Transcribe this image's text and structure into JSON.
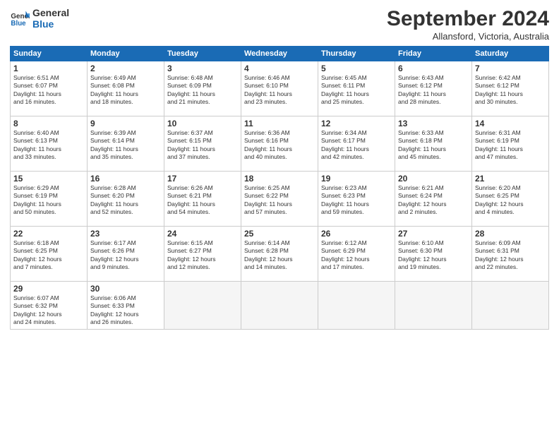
{
  "logo": {
    "line1": "General",
    "line2": "Blue"
  },
  "title": "September 2024",
  "location": "Allansford, Victoria, Australia",
  "days_header": [
    "Sunday",
    "Monday",
    "Tuesday",
    "Wednesday",
    "Thursday",
    "Friday",
    "Saturday"
  ],
  "weeks": [
    [
      {
        "day": "1",
        "text": "Sunrise: 6:51 AM\nSunset: 6:07 PM\nDaylight: 11 hours\nand 16 minutes."
      },
      {
        "day": "2",
        "text": "Sunrise: 6:49 AM\nSunset: 6:08 PM\nDaylight: 11 hours\nand 18 minutes."
      },
      {
        "day": "3",
        "text": "Sunrise: 6:48 AM\nSunset: 6:09 PM\nDaylight: 11 hours\nand 21 minutes."
      },
      {
        "day": "4",
        "text": "Sunrise: 6:46 AM\nSunset: 6:10 PM\nDaylight: 11 hours\nand 23 minutes."
      },
      {
        "day": "5",
        "text": "Sunrise: 6:45 AM\nSunset: 6:11 PM\nDaylight: 11 hours\nand 25 minutes."
      },
      {
        "day": "6",
        "text": "Sunrise: 6:43 AM\nSunset: 6:12 PM\nDaylight: 11 hours\nand 28 minutes."
      },
      {
        "day": "7",
        "text": "Sunrise: 6:42 AM\nSunset: 6:12 PM\nDaylight: 11 hours\nand 30 minutes."
      }
    ],
    [
      {
        "day": "8",
        "text": "Sunrise: 6:40 AM\nSunset: 6:13 PM\nDaylight: 11 hours\nand 33 minutes."
      },
      {
        "day": "9",
        "text": "Sunrise: 6:39 AM\nSunset: 6:14 PM\nDaylight: 11 hours\nand 35 minutes."
      },
      {
        "day": "10",
        "text": "Sunrise: 6:37 AM\nSunset: 6:15 PM\nDaylight: 11 hours\nand 37 minutes."
      },
      {
        "day": "11",
        "text": "Sunrise: 6:36 AM\nSunset: 6:16 PM\nDaylight: 11 hours\nand 40 minutes."
      },
      {
        "day": "12",
        "text": "Sunrise: 6:34 AM\nSunset: 6:17 PM\nDaylight: 11 hours\nand 42 minutes."
      },
      {
        "day": "13",
        "text": "Sunrise: 6:33 AM\nSunset: 6:18 PM\nDaylight: 11 hours\nand 45 minutes."
      },
      {
        "day": "14",
        "text": "Sunrise: 6:31 AM\nSunset: 6:19 PM\nDaylight: 11 hours\nand 47 minutes."
      }
    ],
    [
      {
        "day": "15",
        "text": "Sunrise: 6:29 AM\nSunset: 6:19 PM\nDaylight: 11 hours\nand 50 minutes."
      },
      {
        "day": "16",
        "text": "Sunrise: 6:28 AM\nSunset: 6:20 PM\nDaylight: 11 hours\nand 52 minutes."
      },
      {
        "day": "17",
        "text": "Sunrise: 6:26 AM\nSunset: 6:21 PM\nDaylight: 11 hours\nand 54 minutes."
      },
      {
        "day": "18",
        "text": "Sunrise: 6:25 AM\nSunset: 6:22 PM\nDaylight: 11 hours\nand 57 minutes."
      },
      {
        "day": "19",
        "text": "Sunrise: 6:23 AM\nSunset: 6:23 PM\nDaylight: 11 hours\nand 59 minutes."
      },
      {
        "day": "20",
        "text": "Sunrise: 6:21 AM\nSunset: 6:24 PM\nDaylight: 12 hours\nand 2 minutes."
      },
      {
        "day": "21",
        "text": "Sunrise: 6:20 AM\nSunset: 6:25 PM\nDaylight: 12 hours\nand 4 minutes."
      }
    ],
    [
      {
        "day": "22",
        "text": "Sunrise: 6:18 AM\nSunset: 6:25 PM\nDaylight: 12 hours\nand 7 minutes."
      },
      {
        "day": "23",
        "text": "Sunrise: 6:17 AM\nSunset: 6:26 PM\nDaylight: 12 hours\nand 9 minutes."
      },
      {
        "day": "24",
        "text": "Sunrise: 6:15 AM\nSunset: 6:27 PM\nDaylight: 12 hours\nand 12 minutes."
      },
      {
        "day": "25",
        "text": "Sunrise: 6:14 AM\nSunset: 6:28 PM\nDaylight: 12 hours\nand 14 minutes."
      },
      {
        "day": "26",
        "text": "Sunrise: 6:12 AM\nSunset: 6:29 PM\nDaylight: 12 hours\nand 17 minutes."
      },
      {
        "day": "27",
        "text": "Sunrise: 6:10 AM\nSunset: 6:30 PM\nDaylight: 12 hours\nand 19 minutes."
      },
      {
        "day": "28",
        "text": "Sunrise: 6:09 AM\nSunset: 6:31 PM\nDaylight: 12 hours\nand 22 minutes."
      }
    ],
    [
      {
        "day": "29",
        "text": "Sunrise: 6:07 AM\nSunset: 6:32 PM\nDaylight: 12 hours\nand 24 minutes."
      },
      {
        "day": "30",
        "text": "Sunrise: 6:06 AM\nSunset: 6:33 PM\nDaylight: 12 hours\nand 26 minutes."
      },
      {
        "day": "",
        "text": ""
      },
      {
        "day": "",
        "text": ""
      },
      {
        "day": "",
        "text": ""
      },
      {
        "day": "",
        "text": ""
      },
      {
        "day": "",
        "text": ""
      }
    ]
  ]
}
